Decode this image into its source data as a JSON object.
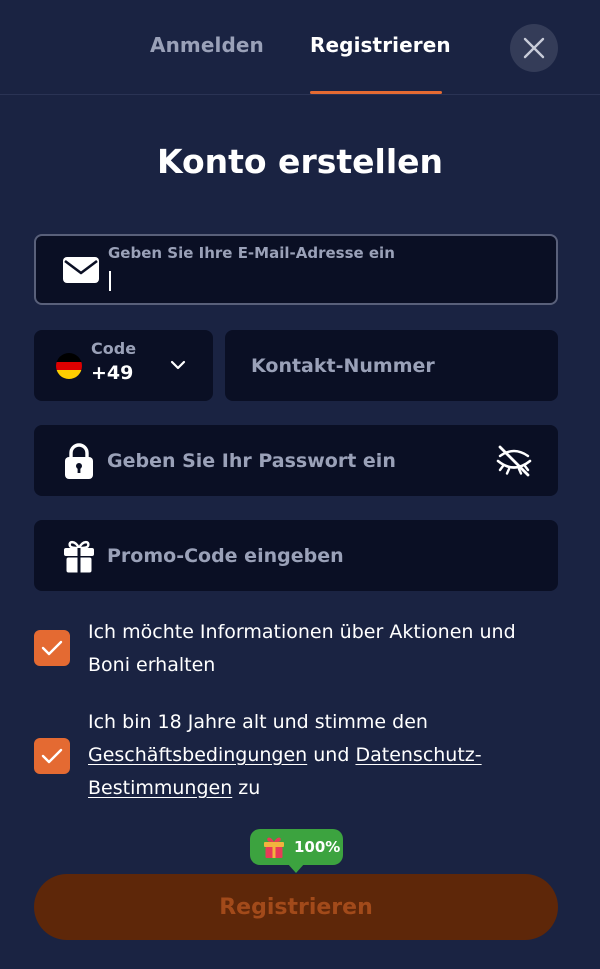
{
  "tabs": {
    "login": "Anmelden",
    "register": "Registrieren",
    "active": "register"
  },
  "title": "Konto erstellen",
  "email": {
    "label": "Geben Sie Ihre E-Mail-Adresse ein",
    "value": ""
  },
  "phone": {
    "code_label": "Code",
    "code_value": "+49",
    "country_flag": "germany-flag",
    "placeholder": "Kontakt-Nummer"
  },
  "password": {
    "placeholder": "Geben Sie Ihr Passwort ein"
  },
  "promo": {
    "placeholder": "Promo-Code eingeben"
  },
  "consents": {
    "promotions": {
      "text": "Ich möchte Informationen über Aktionen und Boni erhalten",
      "checked": true
    },
    "terms": {
      "prefix": "Ich bin 18 Jahre alt und stimme den",
      "link_terms": "Geschäftsbedingungen",
      "middle": "und",
      "link_privacy": "Datenschutz-Bestimmungen",
      "suffix": "zu",
      "checked": true
    }
  },
  "bonus_badge": {
    "icon": "gift-icon",
    "text": "100%"
  },
  "submit": {
    "label": "Registrieren"
  },
  "colors": {
    "accent": "#e46a32",
    "modal_bg": "#1a2342",
    "field_bg": "#0a0f24",
    "badge": "#3ca33f",
    "submit_bg": "#5e2709",
    "submit_text": "#a24a1a"
  }
}
